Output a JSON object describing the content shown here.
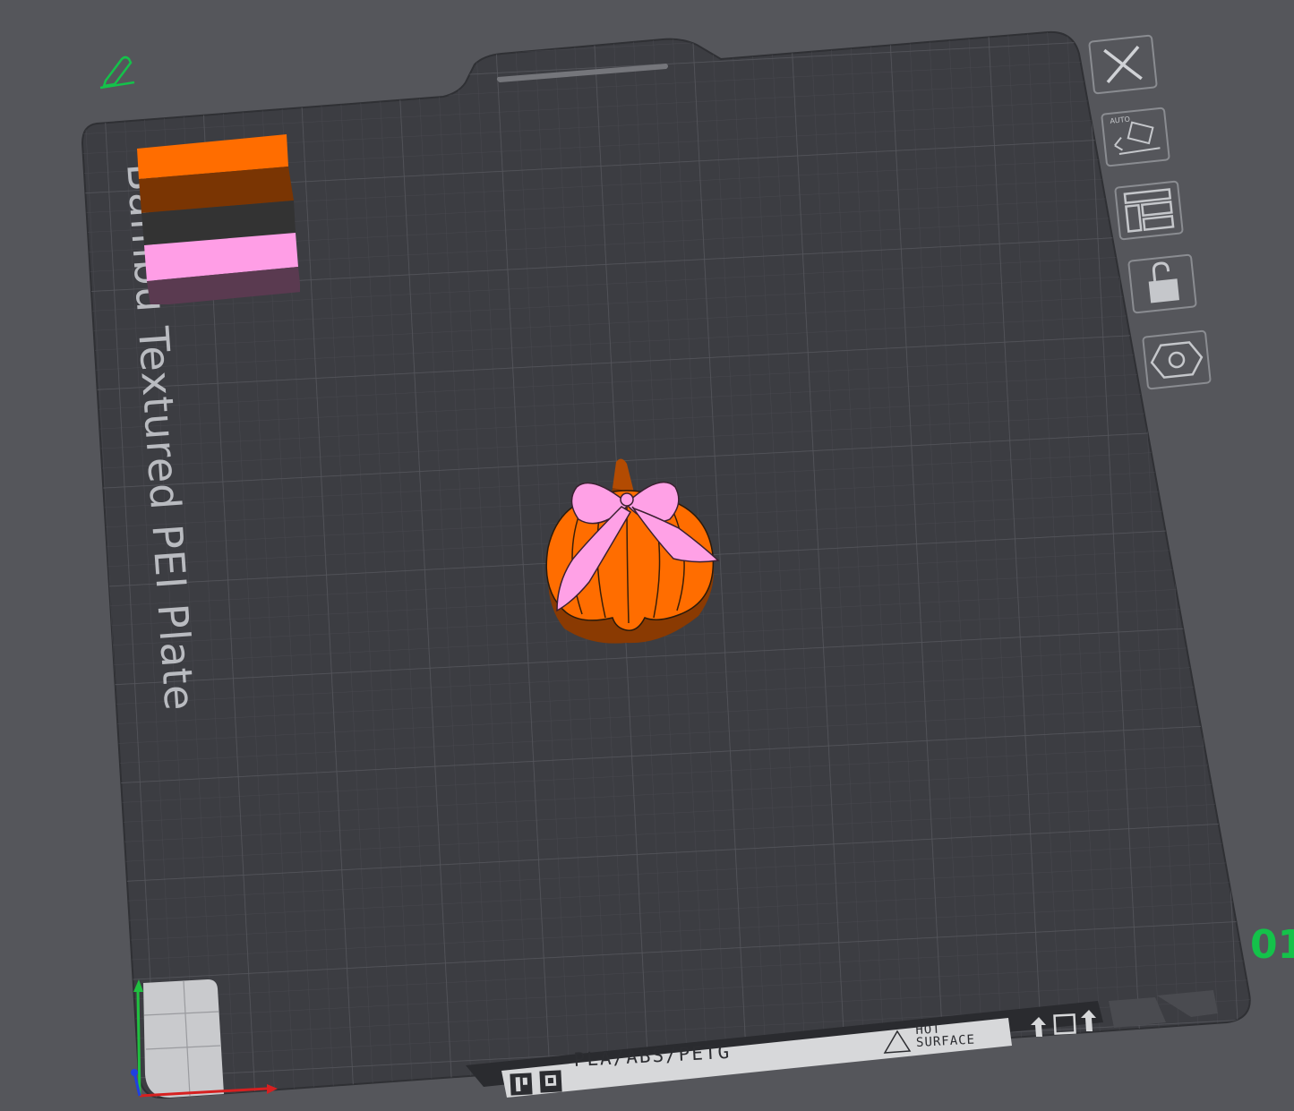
{
  "plate": {
    "label": "Bambu Textured PEI Plate",
    "filament_types": "PLA/ABS/PETG",
    "hot_surface_line1": "HOT",
    "hot_surface_line2": "SURFACE",
    "plate_number": "01"
  },
  "toolbar": {
    "items": [
      {
        "name": "close",
        "icon": "close-icon"
      },
      {
        "name": "auto-orient",
        "icon": "auto-orient-icon",
        "badge": "AUTO"
      },
      {
        "name": "arrange",
        "icon": "arrange-layout-icon"
      },
      {
        "name": "lock",
        "icon": "unlock-icon"
      },
      {
        "name": "plate-settings",
        "icon": "hexagon-settings-icon"
      }
    ]
  },
  "filament_swatches": [
    {
      "color": "#ff6d00"
    },
    {
      "color": "#7a3503"
    },
    {
      "color": "#333333"
    },
    {
      "color": "#ff9ee6"
    }
  ],
  "colors": {
    "background": "#55565b",
    "plate": "#3c3d42",
    "grid": "#4b4c52",
    "pumpkin": "#ff6d00",
    "bow": "#ffa1e6",
    "counter": "#14c24a",
    "edit_icon": "#14c24a"
  }
}
